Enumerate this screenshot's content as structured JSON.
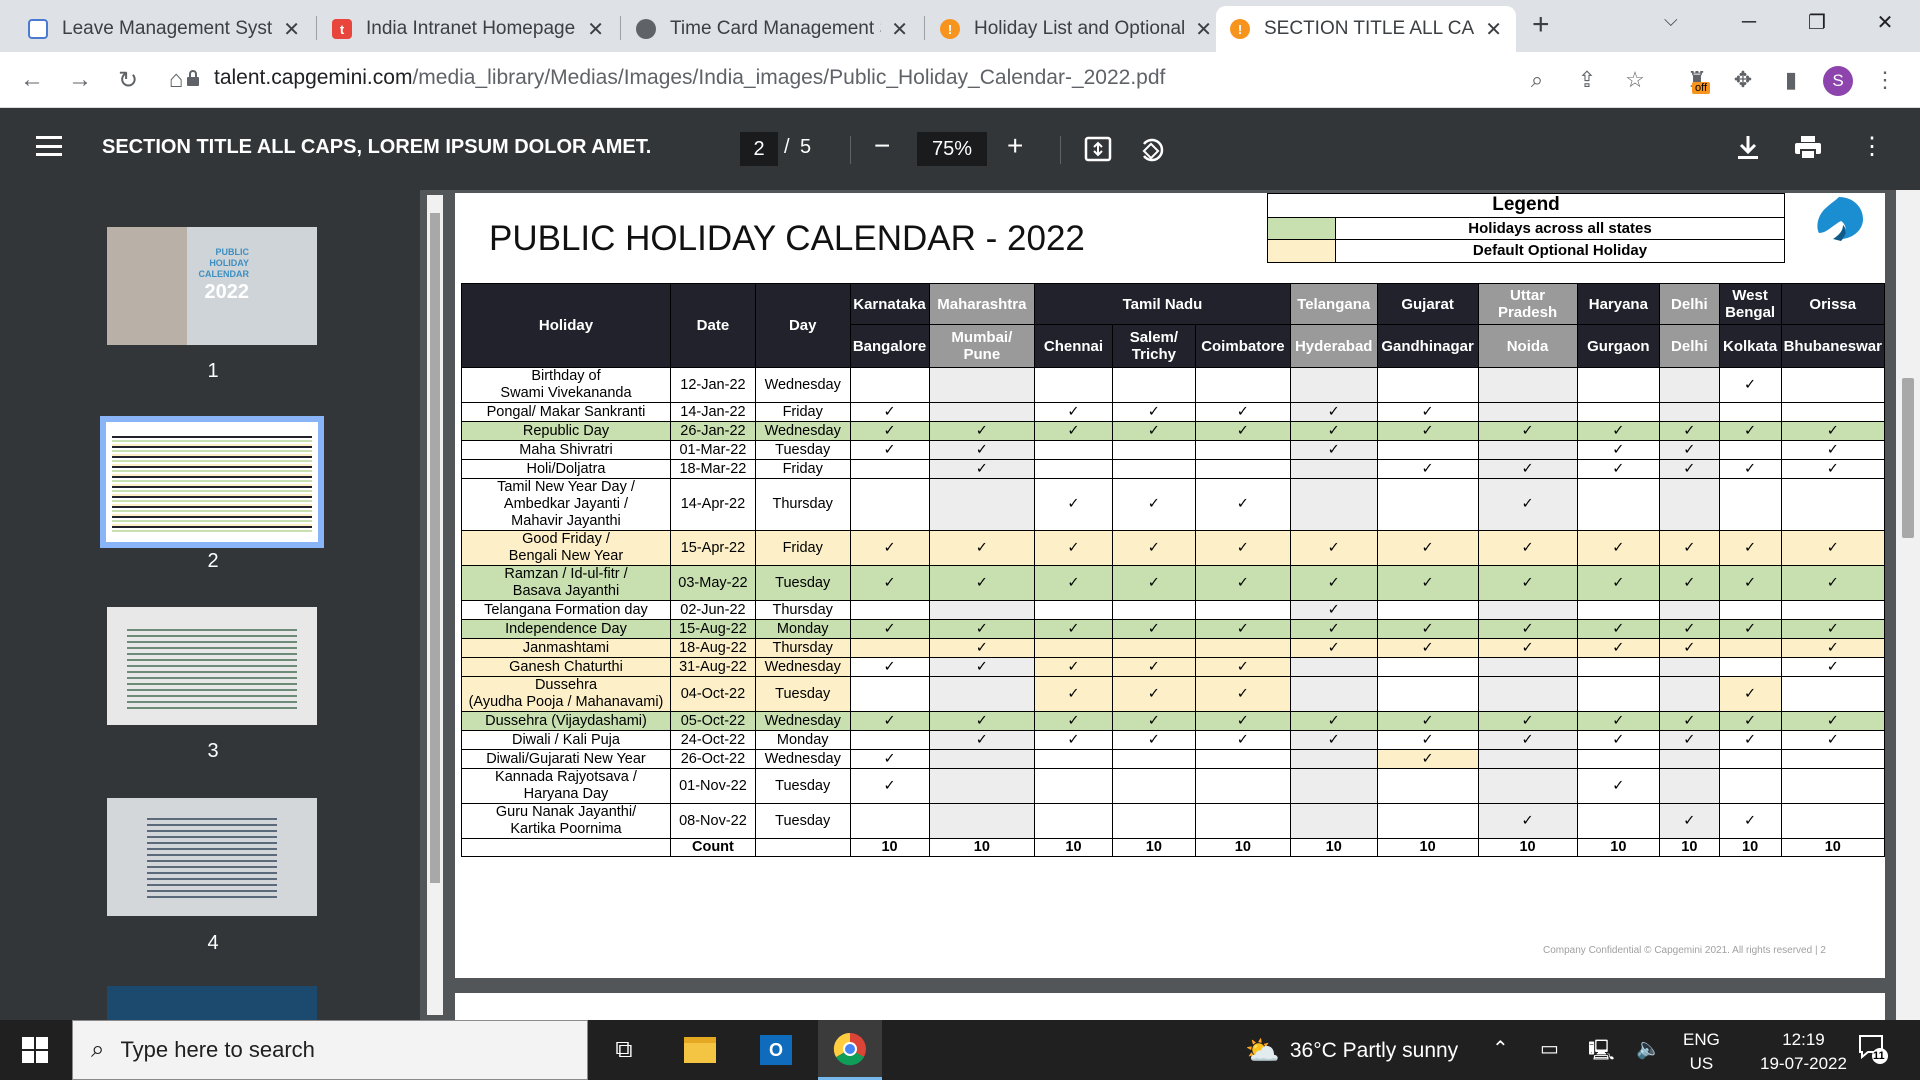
{
  "browser": {
    "tabs": [
      {
        "title": "Leave Management Syste",
        "icon": "doc-icon",
        "color": "#4a7bd0"
      },
      {
        "title": "India Intranet Homepage",
        "icon": "t-icon",
        "color": "#e8453c"
      },
      {
        "title": "Time Card Management S",
        "icon": "globe-icon",
        "color": "#5f6368"
      },
      {
        "title": "Holiday List and Optional",
        "icon": "orange-icon",
        "color": "#f7941d"
      },
      {
        "title": "SECTION TITLE ALL CAPS,",
        "icon": "orange-icon",
        "color": "#f7941d"
      }
    ],
    "new_tab": "+",
    "url_host": "talent.capgemini.com",
    "url_path": "/media_library/Medias/Images/India_images/Public_Holiday_Calendar-_2022.pdf",
    "extension_badge": "off",
    "profile_initial": "S"
  },
  "pdf": {
    "title": "SECTION TITLE ALL CAPS, LOREM IPSUM DOLOR AMET.",
    "current_page": "2",
    "page_sep": "/",
    "total_pages": "5",
    "zoom": "75%",
    "thumbnails": [
      "1",
      "2",
      "3",
      "4"
    ],
    "thumb1_text": [
      "PUBLIC",
      "HOLIDAY",
      "CALENDAR",
      "2022"
    ]
  },
  "doc": {
    "title": "PUBLIC HOLIDAY CALENDAR - 2022",
    "legend": {
      "heading": "Legend",
      "items": [
        {
          "label": "Holidays across all states",
          "color": "#c8e0b0"
        },
        {
          "label": "Default Optional Holiday",
          "color": "#fdf0c8"
        }
      ]
    },
    "header": {
      "holiday": "Holiday",
      "date": "Date",
      "day": "Day"
    },
    "states": [
      {
        "name": "Karnataka",
        "span": 1
      },
      {
        "name": "Maharashtra",
        "span": 1
      },
      {
        "name": "Tamil Nadu",
        "span": 3
      },
      {
        "name": "Telangana",
        "span": 1
      },
      {
        "name": "Gujarat",
        "span": 1
      },
      {
        "name": "Uttar Pradesh",
        "span": 1
      },
      {
        "name": "Haryana",
        "span": 1
      },
      {
        "name": "Delhi",
        "span": 1
      },
      {
        "name": "West Bengal",
        "span": 1
      },
      {
        "name": "Orissa",
        "span": 1
      }
    ],
    "cities": [
      "Bangalore",
      "Mumbai/ Pune",
      "Chennai",
      "Salem/ Trichy",
      "Coimbatore",
      "Hyderabad",
      "Gandhinagar",
      "Noida",
      "Gurgaon",
      "Delhi",
      "Kolkata",
      "Bhubaneswar"
    ],
    "checkmark": "✓",
    "rows": [
      {
        "holiday": "Birthday of\nSwami Vivekananda",
        "date": "12-Jan-22",
        "day": "Wednesday",
        "type": "",
        "marks": [
          0,
          0,
          0,
          0,
          0,
          0,
          0,
          0,
          0,
          0,
          1,
          0
        ]
      },
      {
        "holiday": "Pongal/ Makar Sankranti",
        "date": "14-Jan-22",
        "day": "Friday",
        "type": "",
        "marks": [
          1,
          0,
          1,
          1,
          1,
          1,
          1,
          0,
          0,
          0,
          0,
          0
        ]
      },
      {
        "holiday": "Republic Day",
        "date": "26-Jan-22",
        "day": "Wednesday",
        "type": "g",
        "marks": [
          1,
          1,
          1,
          1,
          1,
          1,
          1,
          1,
          1,
          1,
          1,
          1
        ]
      },
      {
        "holiday": "Maha Shivratri",
        "date": "01-Mar-22",
        "day": "Tuesday",
        "type": "",
        "marks": [
          1,
          1,
          0,
          0,
          0,
          1,
          0,
          0,
          1,
          1,
          0,
          1
        ]
      },
      {
        "holiday": "Holi/Doljatra",
        "date": "18-Mar-22",
        "day": "Friday",
        "type": "",
        "marks": [
          0,
          1,
          0,
          0,
          0,
          0,
          1,
          1,
          1,
          1,
          1,
          1
        ]
      },
      {
        "holiday": "Tamil New Year Day /\nAmbedkar Jayanti /\nMahavir Jayanthi",
        "date": "14-Apr-22",
        "day": "Thursday",
        "type": "",
        "marks": [
          0,
          0,
          1,
          1,
          1,
          0,
          0,
          1,
          0,
          0,
          0,
          0
        ]
      },
      {
        "holiday": "Good Friday /\nBengali New Year",
        "date": "15-Apr-22",
        "day": "Friday",
        "type": "y",
        "marks": [
          1,
          1,
          1,
          1,
          1,
          1,
          1,
          1,
          1,
          1,
          1,
          1
        ]
      },
      {
        "holiday": "Ramzan / Id-ul-fitr /\nBasava Jayanthi",
        "date": "03-May-22",
        "day": "Tuesday",
        "type": "g",
        "marks": [
          1,
          1,
          1,
          1,
          1,
          1,
          1,
          1,
          1,
          1,
          1,
          1
        ]
      },
      {
        "holiday": "Telangana Formation day",
        "date": "02-Jun-22",
        "day": "Thursday",
        "type": "",
        "marks": [
          0,
          0,
          0,
          0,
          0,
          1,
          0,
          0,
          0,
          0,
          0,
          0
        ]
      },
      {
        "holiday": "Independence Day",
        "date": "15-Aug-22",
        "day": "Monday",
        "type": "g",
        "marks": [
          1,
          1,
          1,
          1,
          1,
          1,
          1,
          1,
          1,
          1,
          1,
          1
        ]
      },
      {
        "holiday": "Janmashtami",
        "date": "18-Aug-22",
        "day": "Thursday",
        "type": "y",
        "marks": [
          0,
          1,
          0,
          0,
          0,
          1,
          1,
          1,
          1,
          1,
          0,
          1
        ]
      },
      {
        "holiday": "Ganesh Chaturthi",
        "date": "31-Aug-22",
        "day": "Wednesday",
        "type": "y3",
        "marks": [
          1,
          1,
          1,
          1,
          1,
          0,
          0,
          0,
          0,
          0,
          0,
          1
        ]
      },
      {
        "holiday": "Dussehra\n(Ayudha Pooja / Mahanavami)",
        "date": "04-Oct-22",
        "day": "Tuesday",
        "type": "y3",
        "marks": [
          0,
          0,
          1,
          1,
          1,
          0,
          0,
          0,
          0,
          0,
          1,
          0
        ]
      },
      {
        "holiday": "Dussehra (Vijaydashami)",
        "date": "05-Oct-22",
        "day": "Wednesday",
        "type": "g",
        "marks": [
          1,
          1,
          1,
          1,
          1,
          1,
          1,
          1,
          1,
          1,
          1,
          1
        ]
      },
      {
        "holiday": "Diwali / Kali Puja",
        "date": "24-Oct-22",
        "day": "Monday",
        "type": "",
        "marks": [
          0,
          1,
          1,
          1,
          1,
          1,
          1,
          1,
          1,
          1,
          1,
          1
        ]
      },
      {
        "holiday": "Diwali/Gujarati New Year",
        "date": "26-Oct-22",
        "day": "Wednesday",
        "type": "",
        "marks": [
          1,
          0,
          0,
          0,
          0,
          0,
          1,
          0,
          0,
          0,
          0,
          0
        ]
      },
      {
        "holiday": "Kannada Rajyotsava /\nHaryana Day",
        "date": "01-Nov-22",
        "day": "Tuesday",
        "type": "",
        "marks": [
          1,
          0,
          0,
          0,
          0,
          0,
          0,
          0,
          1,
          0,
          0,
          0
        ]
      },
      {
        "holiday": "Guru Nanak Jayanthi/\nKartika Poornima",
        "date": "08-Nov-22",
        "day": "Tuesday",
        "type": "",
        "marks": [
          0,
          0,
          0,
          0,
          0,
          0,
          0,
          1,
          0,
          1,
          1,
          0
        ]
      }
    ],
    "count_label": "Count",
    "counts": [
      "10",
      "10",
      "10",
      "10",
      "10",
      "10",
      "10",
      "10",
      "10",
      "10",
      "10",
      "10"
    ],
    "footer": "Company Confidential © Capgemini 2021. All rights reserved  |     2"
  },
  "taskbar": {
    "search_placeholder": "Type here to search",
    "weather": "36°C  Partly sunny",
    "lang1": "ENG",
    "lang2": "US",
    "time": "12:19",
    "date": "19-07-2022",
    "notif_count": "11"
  }
}
